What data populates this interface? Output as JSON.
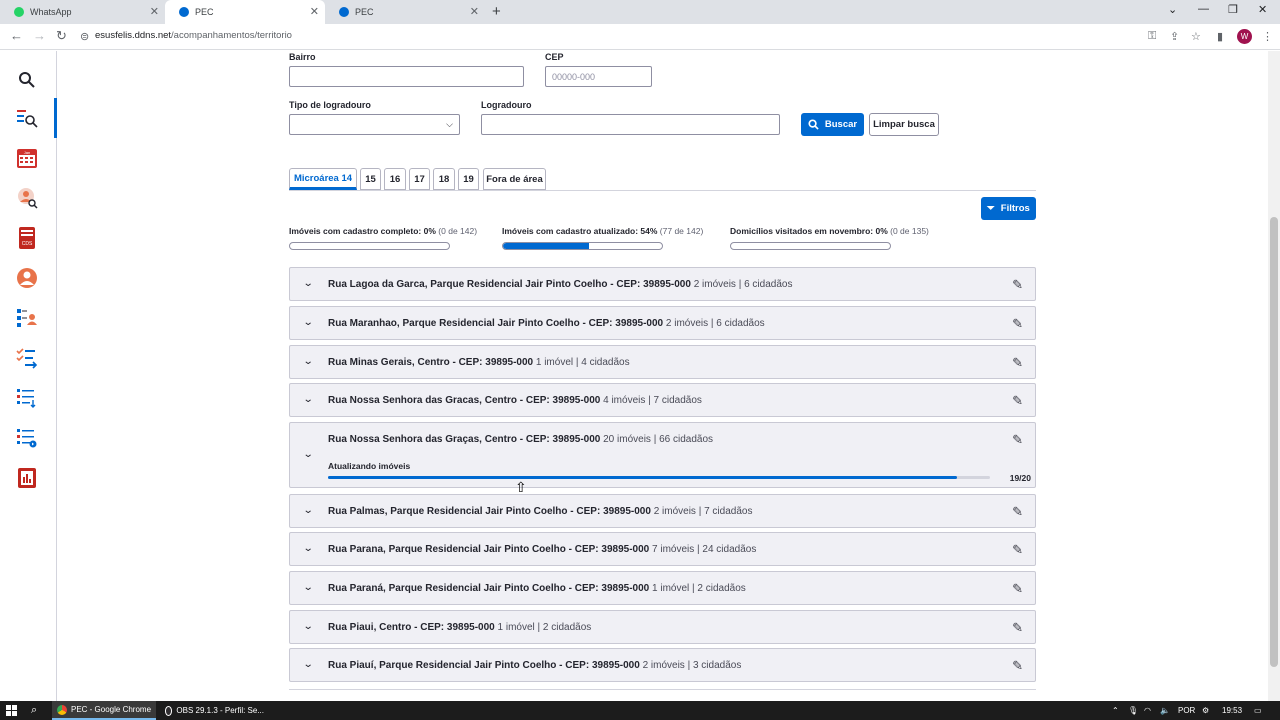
{
  "browser": {
    "tabs": [
      {
        "title": "WhatsApp",
        "icon": "whatsapp-icon",
        "color": "#25d366"
      },
      {
        "title": "PEC",
        "icon": "pec-icon",
        "color": "#0069d0"
      },
      {
        "title": "PEC",
        "icon": "pec-icon",
        "color": "#0069d0"
      }
    ],
    "url_host": "esusfelis.ddns.net",
    "url_path": "/acompanhamentos/territorio",
    "profile_initial": "W"
  },
  "sidebar": {
    "icons": [
      "search-icon",
      "territory-icon",
      "calendar-icon",
      "patient-search-icon",
      "cds-icon",
      "user-icon",
      "team-icon",
      "checklist-icon",
      "list-icon",
      "report-list-icon",
      "chart-icon"
    ],
    "calendar_label": "Jan",
    "cds_label": "CDS"
  },
  "form": {
    "bairro_label": "Bairro",
    "cep_label": "CEP",
    "cep_placeholder": "00000-000",
    "tipo_label": "Tipo de logradouro",
    "logradouro_label": "Logradouro",
    "buscar": "Buscar",
    "limpar": "Limpar busca"
  },
  "tabs": [
    "Microárea 14",
    "15",
    "16",
    "17",
    "18",
    "19",
    "Fora de área"
  ],
  "filtros": "Filtros",
  "stats": [
    {
      "label": "Imóveis com cadastro completo: 0%",
      "detail": "(0 de 142)",
      "progress": 0.0
    },
    {
      "label": "Imóveis com cadastro atualizado: 54%",
      "detail": "(77 de 142)",
      "progress": 0.54
    },
    {
      "label": "Domicílios visitados em novembro: 0%",
      "detail": "(0 de 135)",
      "progress": 0.0
    }
  ],
  "streets": [
    {
      "name": "Rua Lagoa da Garca, Parque Residencial Jair Pinto Coelho - CEP: 39895-000",
      "count": "2 imóveis | 6 cidadãos"
    },
    {
      "name": "Rua Maranhao, Parque Residencial Jair Pinto Coelho - CEP: 39895-000",
      "count": "2 imóveis | 6 cidadãos"
    },
    {
      "name": "Rua Minas Gerais, Centro - CEP: 39895-000",
      "count": "1 imóvel | 4 cidadãos"
    },
    {
      "name": "Rua Nossa Senhora das Gracas, Centro - CEP: 39895-000",
      "count": "4 imóveis | 7 cidadãos"
    },
    {
      "name": "Rua Nossa Senhora das Graças, Centro - CEP: 39895-000",
      "count": "20 imóveis | 66 cidadãos",
      "updating_label": "Atualizando imóveis",
      "updating_count": "19/20",
      "updating_progress": 0.95
    },
    {
      "name": "Rua Palmas, Parque Residencial Jair Pinto Coelho - CEP: 39895-000",
      "count": "2 imóveis | 7 cidadãos"
    },
    {
      "name": "Rua Parana, Parque Residencial Jair Pinto Coelho - CEP: 39895-000",
      "count": "7 imóveis | 24 cidadãos"
    },
    {
      "name": "Rua Paraná, Parque Residencial Jair Pinto Coelho - CEP: 39895-000",
      "count": "1 imóvel | 2 cidadãos"
    },
    {
      "name": "Rua Piaui, Centro - CEP: 39895-000",
      "count": "1 imóvel | 2 cidadãos"
    },
    {
      "name": "Rua Piauí, Parque Residencial Jair Pinto Coelho - CEP: 39895-000",
      "count": "2 imóveis | 3 cidadãos"
    }
  ],
  "taskbar": {
    "chrome": "PEC - Google Chrome",
    "obs": "OBS 29.1.3 - Perfil: Se...",
    "lang": "POR",
    "time": "19:53"
  }
}
